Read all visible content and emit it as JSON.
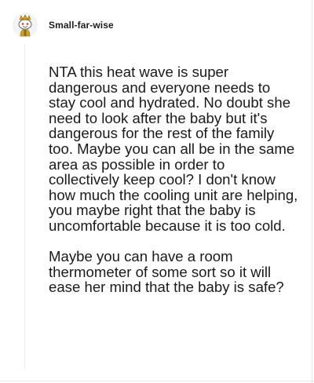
{
  "comment": {
    "username": "Small-far-wise",
    "paragraphs": [
      "NTA this heat wave is super dangerous and everyone needs to stay cool and hydrated. No doubt she need to look after the baby but it's dangerous for the rest of the family too. Maybe you can all be in the same area as possible in order to collectively keep cool? I don't know how much the cooling unit are helping, you maybe right that the baby is uncomfortable because it is too cold.",
      "Maybe you can have a room thermometer of some sort so it will ease her mind that the baby is safe?"
    ],
    "avatar_icon": "reddit-snoo-avatar-icon"
  },
  "colors": {
    "text": "#1a1a1b",
    "thread_line": "#ededed",
    "avatar_gold": "#c9a227"
  }
}
